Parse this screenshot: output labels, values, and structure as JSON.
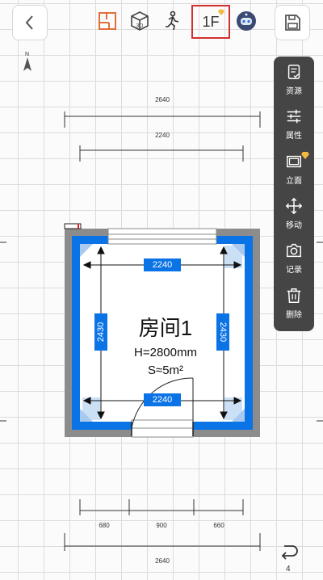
{
  "toolbar": {
    "back_icon": "chevron-left-icon",
    "floorplan_icon": "floorplan-icon",
    "view3d_label": "3D",
    "walk_icon": "walking-person-icon",
    "floor_label": "1F",
    "ai_icon": "robot-avatar-icon",
    "save_icon": "save-icon",
    "gem_color": "#f5b942",
    "highlight_color": "#d32f2f"
  },
  "side_panel": {
    "items": [
      {
        "label": "资源",
        "icon": "resource-icon"
      },
      {
        "label": "属性",
        "icon": "sliders-icon"
      },
      {
        "label": "立面",
        "icon": "elevation-icon"
      },
      {
        "label": "移动",
        "icon": "move-icon"
      },
      {
        "label": "记录",
        "icon": "camera-icon"
      },
      {
        "label": "删除",
        "icon": "trash-icon"
      }
    ]
  },
  "dimensions": {
    "top_outer": "2640",
    "top_inner": "2240",
    "bottom_left": "680",
    "bottom_mid": "900",
    "bottom_right": "660",
    "bottom_outer": "2640"
  },
  "room": {
    "name": "房间1",
    "height": "H=2800mm",
    "area": "S≈5m²",
    "badge_top": "2240",
    "badge_bottom": "2240",
    "badge_left": "2430",
    "badge_right": "2430",
    "accent": "#0a73e6"
  },
  "compass": {
    "label": "N"
  },
  "undo": {
    "count": "4",
    "icon": "undo-icon"
  }
}
